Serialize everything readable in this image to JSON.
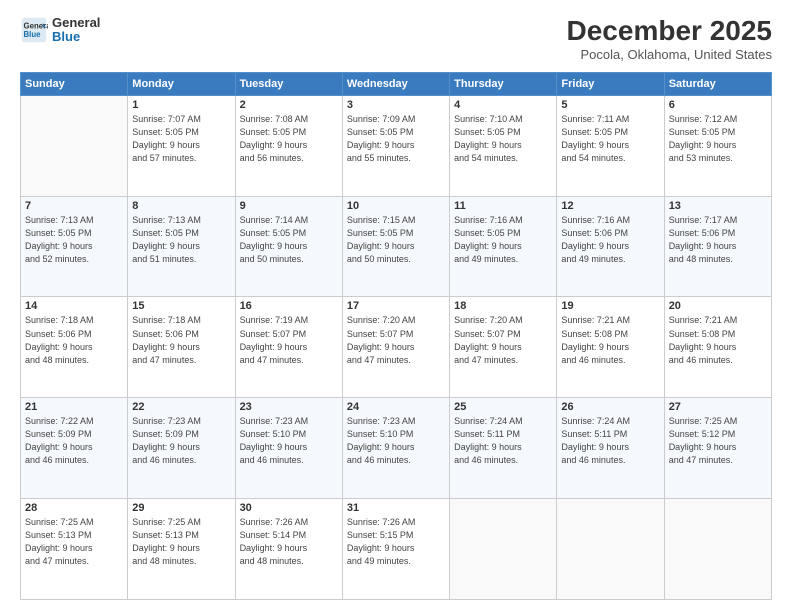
{
  "logo": {
    "line1": "General",
    "line2": "Blue"
  },
  "title": "December 2025",
  "subtitle": "Pocola, Oklahoma, United States",
  "weekdays": [
    "Sunday",
    "Monday",
    "Tuesday",
    "Wednesday",
    "Thursday",
    "Friday",
    "Saturday"
  ],
  "weeks": [
    [
      {
        "num": "",
        "info": ""
      },
      {
        "num": "1",
        "info": "Sunrise: 7:07 AM\nSunset: 5:05 PM\nDaylight: 9 hours\nand 57 minutes."
      },
      {
        "num": "2",
        "info": "Sunrise: 7:08 AM\nSunset: 5:05 PM\nDaylight: 9 hours\nand 56 minutes."
      },
      {
        "num": "3",
        "info": "Sunrise: 7:09 AM\nSunset: 5:05 PM\nDaylight: 9 hours\nand 55 minutes."
      },
      {
        "num": "4",
        "info": "Sunrise: 7:10 AM\nSunset: 5:05 PM\nDaylight: 9 hours\nand 54 minutes."
      },
      {
        "num": "5",
        "info": "Sunrise: 7:11 AM\nSunset: 5:05 PM\nDaylight: 9 hours\nand 54 minutes."
      },
      {
        "num": "6",
        "info": "Sunrise: 7:12 AM\nSunset: 5:05 PM\nDaylight: 9 hours\nand 53 minutes."
      }
    ],
    [
      {
        "num": "7",
        "info": "Sunrise: 7:13 AM\nSunset: 5:05 PM\nDaylight: 9 hours\nand 52 minutes."
      },
      {
        "num": "8",
        "info": "Sunrise: 7:13 AM\nSunset: 5:05 PM\nDaylight: 9 hours\nand 51 minutes."
      },
      {
        "num": "9",
        "info": "Sunrise: 7:14 AM\nSunset: 5:05 PM\nDaylight: 9 hours\nand 50 minutes."
      },
      {
        "num": "10",
        "info": "Sunrise: 7:15 AM\nSunset: 5:05 PM\nDaylight: 9 hours\nand 50 minutes."
      },
      {
        "num": "11",
        "info": "Sunrise: 7:16 AM\nSunset: 5:05 PM\nDaylight: 9 hours\nand 49 minutes."
      },
      {
        "num": "12",
        "info": "Sunrise: 7:16 AM\nSunset: 5:06 PM\nDaylight: 9 hours\nand 49 minutes."
      },
      {
        "num": "13",
        "info": "Sunrise: 7:17 AM\nSunset: 5:06 PM\nDaylight: 9 hours\nand 48 minutes."
      }
    ],
    [
      {
        "num": "14",
        "info": "Sunrise: 7:18 AM\nSunset: 5:06 PM\nDaylight: 9 hours\nand 48 minutes."
      },
      {
        "num": "15",
        "info": "Sunrise: 7:18 AM\nSunset: 5:06 PM\nDaylight: 9 hours\nand 47 minutes."
      },
      {
        "num": "16",
        "info": "Sunrise: 7:19 AM\nSunset: 5:07 PM\nDaylight: 9 hours\nand 47 minutes."
      },
      {
        "num": "17",
        "info": "Sunrise: 7:20 AM\nSunset: 5:07 PM\nDaylight: 9 hours\nand 47 minutes."
      },
      {
        "num": "18",
        "info": "Sunrise: 7:20 AM\nSunset: 5:07 PM\nDaylight: 9 hours\nand 47 minutes."
      },
      {
        "num": "19",
        "info": "Sunrise: 7:21 AM\nSunset: 5:08 PM\nDaylight: 9 hours\nand 46 minutes."
      },
      {
        "num": "20",
        "info": "Sunrise: 7:21 AM\nSunset: 5:08 PM\nDaylight: 9 hours\nand 46 minutes."
      }
    ],
    [
      {
        "num": "21",
        "info": "Sunrise: 7:22 AM\nSunset: 5:09 PM\nDaylight: 9 hours\nand 46 minutes."
      },
      {
        "num": "22",
        "info": "Sunrise: 7:23 AM\nSunset: 5:09 PM\nDaylight: 9 hours\nand 46 minutes."
      },
      {
        "num": "23",
        "info": "Sunrise: 7:23 AM\nSunset: 5:10 PM\nDaylight: 9 hours\nand 46 minutes."
      },
      {
        "num": "24",
        "info": "Sunrise: 7:23 AM\nSunset: 5:10 PM\nDaylight: 9 hours\nand 46 minutes."
      },
      {
        "num": "25",
        "info": "Sunrise: 7:24 AM\nSunset: 5:11 PM\nDaylight: 9 hours\nand 46 minutes."
      },
      {
        "num": "26",
        "info": "Sunrise: 7:24 AM\nSunset: 5:11 PM\nDaylight: 9 hours\nand 46 minutes."
      },
      {
        "num": "27",
        "info": "Sunrise: 7:25 AM\nSunset: 5:12 PM\nDaylight: 9 hours\nand 47 minutes."
      }
    ],
    [
      {
        "num": "28",
        "info": "Sunrise: 7:25 AM\nSunset: 5:13 PM\nDaylight: 9 hours\nand 47 minutes."
      },
      {
        "num": "29",
        "info": "Sunrise: 7:25 AM\nSunset: 5:13 PM\nDaylight: 9 hours\nand 48 minutes."
      },
      {
        "num": "30",
        "info": "Sunrise: 7:26 AM\nSunset: 5:14 PM\nDaylight: 9 hours\nand 48 minutes."
      },
      {
        "num": "31",
        "info": "Sunrise: 7:26 AM\nSunset: 5:15 PM\nDaylight: 9 hours\nand 49 minutes."
      },
      {
        "num": "",
        "info": ""
      },
      {
        "num": "",
        "info": ""
      },
      {
        "num": "",
        "info": ""
      }
    ]
  ]
}
